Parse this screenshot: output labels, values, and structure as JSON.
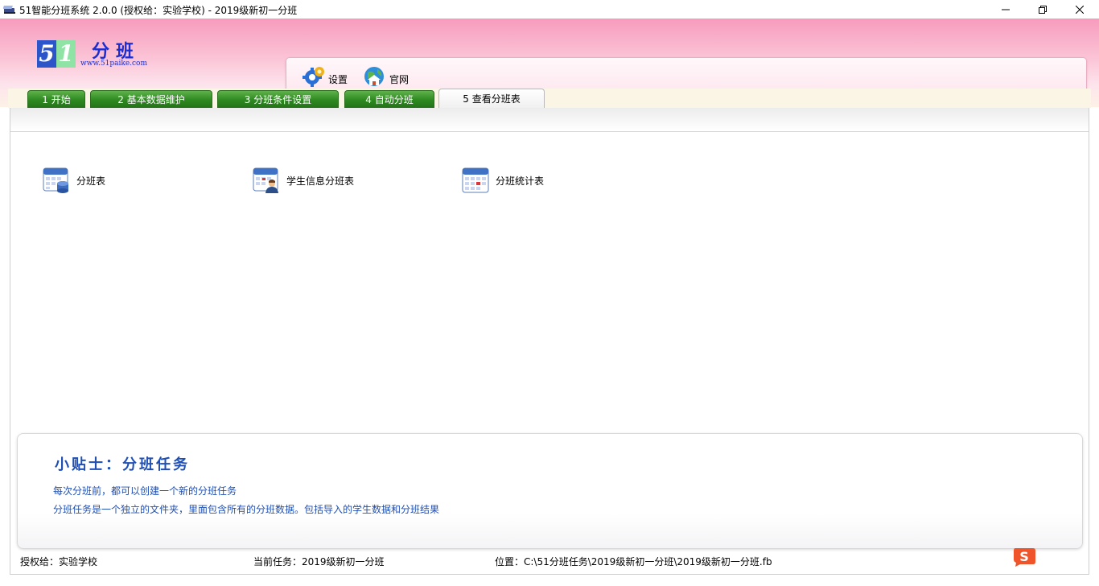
{
  "window": {
    "title": "51智能分班系统 2.0.0 (授权给：实验学校) - 2019级新初一分班",
    "app_icon": "pencil-app-icon",
    "controls": [
      "minimize-icon",
      "restore-icon",
      "close-icon"
    ]
  },
  "logo": {
    "digit_5": "5",
    "digit_1": "1",
    "name": "分班",
    "url": "www.51paike.com",
    "colors": {
      "blue": "#2b55c9",
      "green": "#8fe3a4",
      "text": "#1a2ed1"
    }
  },
  "toolbar": {
    "settings_label": "设置",
    "settings_icon": "gear-icon",
    "website_label": "官网",
    "website_icon": "globe-home-icon"
  },
  "tabs": [
    {
      "label": "1 开始"
    },
    {
      "label": "2 基本数据维护"
    },
    {
      "label": "3 分班条件设置"
    },
    {
      "label": "4 自动分班"
    },
    {
      "label": "5 查看分班表",
      "active": true
    }
  ],
  "reports": [
    {
      "label": "分班表",
      "icon": "calendar-database-icon"
    },
    {
      "label": "学生信息分班表",
      "icon": "calendar-user-icon"
    },
    {
      "label": "分班统计表",
      "icon": "calendar-grid-icon"
    }
  ],
  "tips": {
    "title": "小贴士：分班任务",
    "line1": "每次分班前，都可以创建一个新的分班任务",
    "line2": "分班任务是一个独立的文件夹，里面包含所有的分班数据。包括导入的学生数据和分班结果"
  },
  "status": {
    "licensed_to": "授权给：实验学校",
    "current_task": "当前任务：2019级新初一分班",
    "location": "位置：C:\\51分班任务\\2019级新初一分班\\2019级新初一分班.fb"
  },
  "ime": {
    "icon": "sogou-ime-icon",
    "glyph": "S"
  },
  "colors": {
    "tab_green": "#2f8a22",
    "tips_blue": "#1f4fb4",
    "header_pink": "#f79bbd"
  }
}
